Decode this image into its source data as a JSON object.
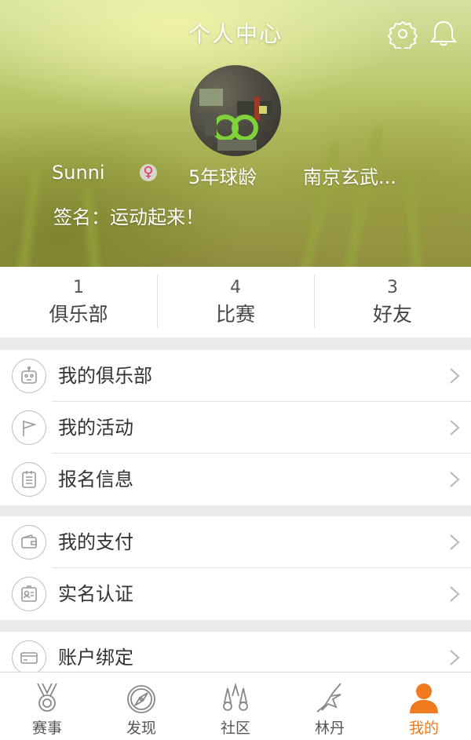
{
  "header": {
    "title": "个人中心",
    "settings_icon": "gear-icon",
    "notification_icon": "bell-icon"
  },
  "profile": {
    "username": "Sunni",
    "gender_symbol": "♀",
    "play_years": "5年球龄",
    "location": "南京玄武...",
    "signature": "签名：运动起来！"
  },
  "stats": [
    {
      "count": "1",
      "label": "俱乐部"
    },
    {
      "count": "4",
      "label": "比赛"
    },
    {
      "count": "3",
      "label": "好友"
    }
  ],
  "menu": {
    "group1": [
      {
        "label": "我的俱乐部",
        "icon": "robot-icon"
      },
      {
        "label": "我的活动",
        "icon": "flag-icon"
      },
      {
        "label": "报名信息",
        "icon": "clipboard-icon"
      }
    ],
    "group2": [
      {
        "label": "我的支付",
        "icon": "wallet-icon"
      },
      {
        "label": "实名认证",
        "icon": "id-card-icon"
      }
    ],
    "group3": [
      {
        "label": "账户绑定",
        "icon": "credit-card-icon"
      }
    ]
  },
  "tabs": [
    {
      "label": "赛事",
      "icon": "medal-icon"
    },
    {
      "label": "发现",
      "icon": "compass-icon"
    },
    {
      "label": "社区",
      "icon": "shuttlecock-icon"
    },
    {
      "label": "林丹",
      "icon": "badminton-player-icon"
    },
    {
      "label": "我的",
      "icon": "user-icon",
      "active": true
    }
  ],
  "colors": {
    "accent": "#f07a20",
    "text": "#333333",
    "icon_stroke": "#9a9a9a"
  }
}
